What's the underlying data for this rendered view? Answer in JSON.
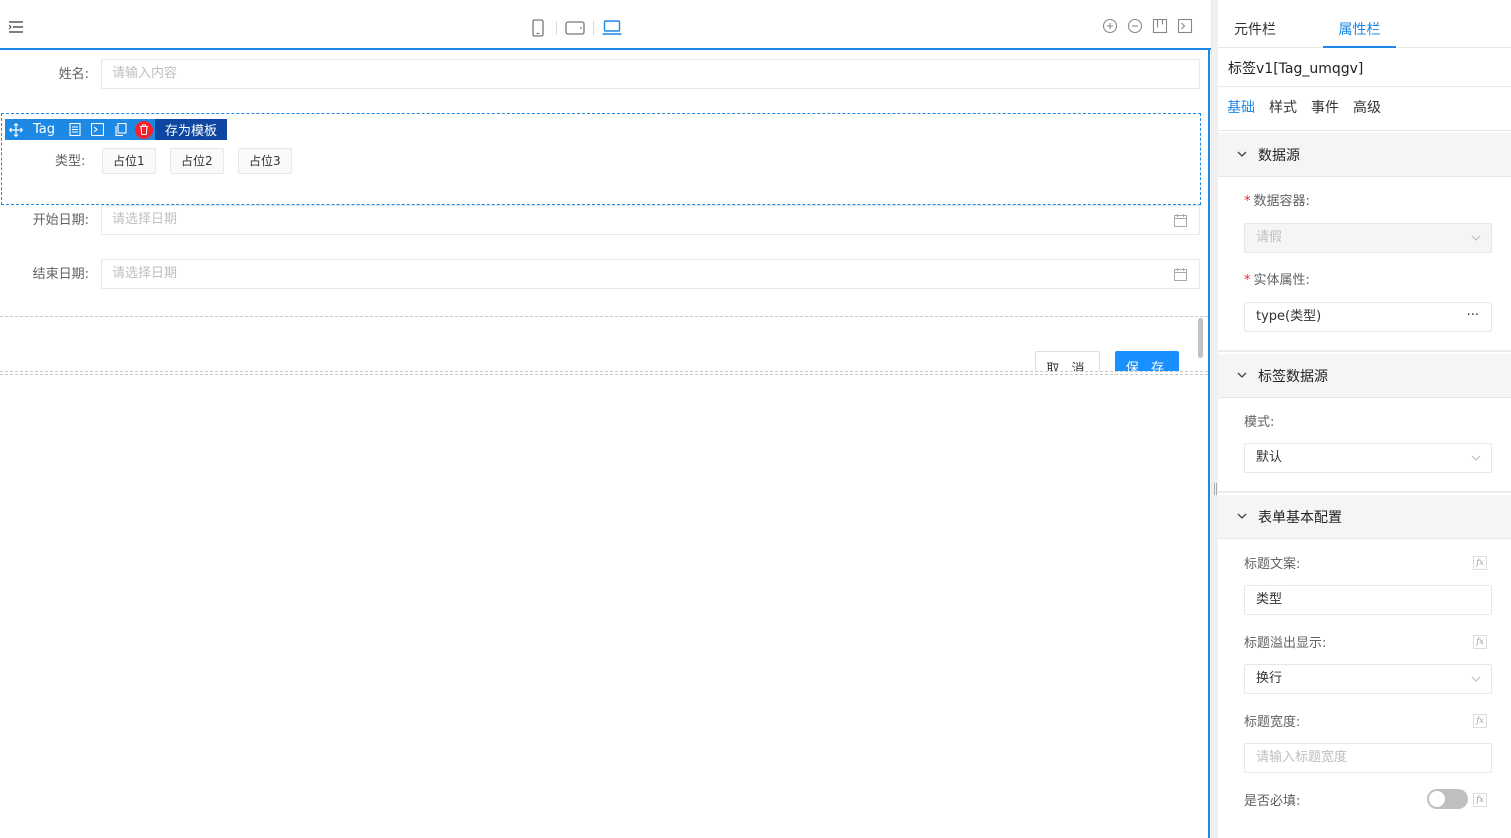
{
  "form": {
    "name_label": "姓名:",
    "name_placeholder": "请输入内容",
    "type_label": "类型:",
    "tag_chips": [
      "占位1",
      "占位2",
      "占位3"
    ],
    "start_label": "开始日期:",
    "start_placeholder": "请选择日期",
    "end_label": "结束日期:",
    "end_placeholder": "请选择日期",
    "cancel_label": "取 消",
    "save_label": "保 存"
  },
  "selection_bar": {
    "component_name": "Tag",
    "save_template_label": "存为模板"
  },
  "panel": {
    "tabs": [
      "元件栏",
      "属性栏"
    ],
    "active_tab": "属性栏",
    "component_title": "标签v1[Tag_umqgv]",
    "subtabs": [
      "基础",
      "样式",
      "事件",
      "高级"
    ],
    "sections": {
      "datasource": {
        "title": "数据源",
        "container_label": "数据容器:",
        "container_value": "请假",
        "entity_label": "实体属性:",
        "entity_value": "type(类型)",
        "entity_more": "···"
      },
      "tag_datasource": {
        "title": "标签数据源",
        "mode_label": "模式:",
        "mode_value": "默认"
      },
      "form_config": {
        "title": "表单基本配置",
        "title_text_label": "标题文案:",
        "title_text_value": "类型",
        "overflow_label": "标题溢出显示:",
        "overflow_value": "换行",
        "width_label": "标题宽度:",
        "width_placeholder": "请输入标题宽度",
        "required_label": "是否必填:"
      }
    }
  },
  "colors": {
    "accent": "#1e88e5",
    "danger": "#f5222d",
    "save_button": "#1890ff"
  }
}
